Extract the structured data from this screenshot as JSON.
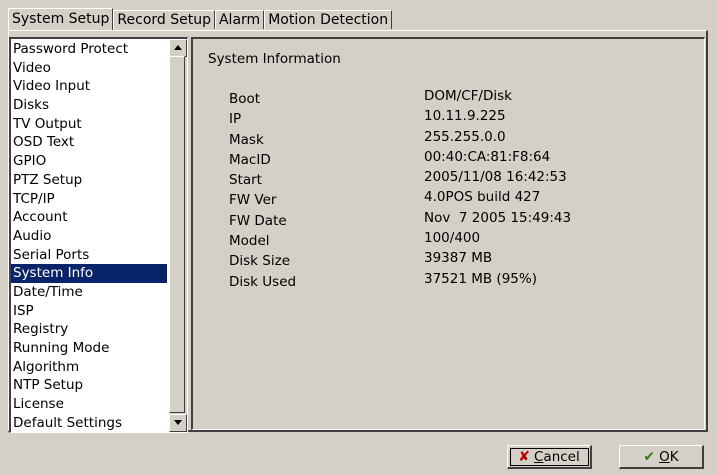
{
  "tabs": [
    {
      "label": "System Setup",
      "active": true
    },
    {
      "label": "Record Setup",
      "active": false
    },
    {
      "label": "Alarm",
      "active": false
    },
    {
      "label": "Motion Detection",
      "active": false
    }
  ],
  "menu": {
    "items": [
      "Password Protect",
      "Video",
      "Video Input",
      "Disks",
      "TV Output",
      "OSD Text",
      "GPIO",
      "PTZ Setup",
      "TCP/IP",
      "Account",
      "Audio",
      "Serial Ports",
      "System Info",
      "Date/Time",
      "ISP",
      "Registry",
      "Running Mode",
      "Algorithm",
      "NTP Setup",
      "License",
      "Default Settings"
    ],
    "selected": "System Info"
  },
  "panel": {
    "title": "System Information",
    "rows": [
      {
        "label": "Boot",
        "value": "DOM/CF/Disk"
      },
      {
        "label": "IP",
        "value": "10.11.9.225"
      },
      {
        "label": "Mask",
        "value": "255.255.0.0"
      },
      {
        "label": "MacID",
        "value": "00:40:CA:81:F8:64"
      },
      {
        "label": "Start",
        "value": "2005/11/08 16:42:53"
      },
      {
        "label": "FW Ver",
        "value": "4.0POS build 427"
      },
      {
        "label": "FW Date",
        "value": "Nov  7 2005 15:49:43"
      },
      {
        "label": "Model",
        "value": "100/400"
      },
      {
        "label": "Disk Size",
        "value": "39387 MB"
      },
      {
        "label": "Disk Used",
        "value": "37521 MB (95%)"
      }
    ]
  },
  "buttons": {
    "cancel": {
      "label": "Cancel",
      "accel": "C",
      "icon": "cross-icon"
    },
    "ok": {
      "label": "OK",
      "accel": "O",
      "icon": "checkmark-icon"
    }
  },
  "colors": {
    "background": "#d4d0c8",
    "selection": "#0a246a"
  }
}
